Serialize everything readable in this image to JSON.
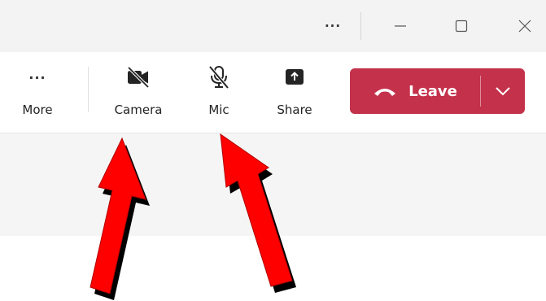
{
  "titlebar": {
    "more_label": "···"
  },
  "toolbar": {
    "more": {
      "icon_text": "···",
      "label": "More"
    },
    "camera": {
      "label": "Camera",
      "icon": "video-off-icon"
    },
    "mic": {
      "label": "Mic",
      "icon": "mic-off-icon"
    },
    "share": {
      "label": "Share",
      "icon": "share-screen-icon"
    },
    "leave": {
      "label": "Leave",
      "icon": "hang-up-icon",
      "chevron_icon": "chevron-down-icon"
    }
  },
  "colors": {
    "leave_bg": "#c4314b",
    "arrow_fill": "#ff0000",
    "arrow_shadow": "#000000",
    "titlebar_bg": "#f3f3f3",
    "content_bg": "#f5f5f5"
  },
  "annotations": [
    {
      "name": "arrow-to-camera",
      "points_to": "Camera"
    },
    {
      "name": "arrow-to-mic",
      "points_to": "Mic"
    }
  ]
}
